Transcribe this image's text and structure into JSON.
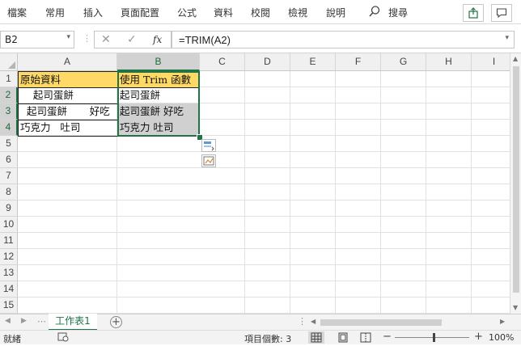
{
  "ribbon": {
    "tabs": [
      "檔案",
      "常用",
      "插入",
      "頁面配置",
      "公式",
      "資料",
      "校閱",
      "檢視",
      "說明"
    ],
    "search_label": "搜尋"
  },
  "formula_bar": {
    "name_box": "B2",
    "cancel_glyph": "✕",
    "enter_glyph": "✓",
    "fx_label": "fx",
    "formula": "=TRIM(A2)"
  },
  "grid": {
    "columns": [
      "A",
      "B",
      "C",
      "D",
      "E",
      "F",
      "G",
      "H",
      "I"
    ],
    "rows": [
      "1",
      "2",
      "3",
      "4",
      "5",
      "6",
      "7",
      "8",
      "9",
      "10",
      "11",
      "12",
      "13",
      "14",
      "15"
    ],
    "cells": {
      "A1": "原始資料",
      "B1": "使用 Trim 函數",
      "A2": "    起司蛋餅",
      "B2": "起司蛋餅",
      "A3": "  起司蛋餅       好吃",
      "B3": "起司蛋餅 好吃",
      "A4": "巧克力   吐司",
      "B4": "巧克力 吐司"
    },
    "colors": {
      "header_fill": "#ffd966",
      "result_fill": "#d0d0d0",
      "selection": "#217346"
    }
  },
  "sheets": {
    "tabs": [
      "工作表1"
    ],
    "add_glyph": "+"
  },
  "status": {
    "mode": "就緒",
    "count_label": "項目個數: 3",
    "zoom": "100%",
    "zoom_out": "−",
    "zoom_in": "+"
  }
}
